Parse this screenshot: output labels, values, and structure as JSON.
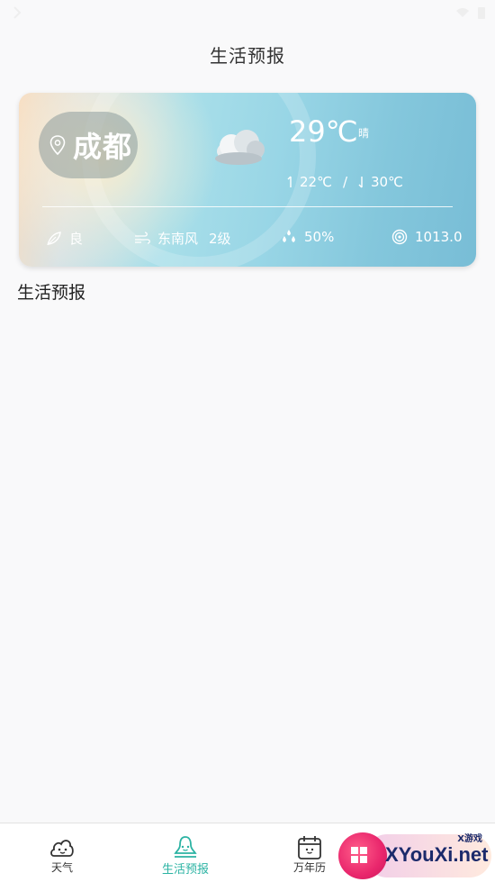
{
  "header": {
    "title": "生活预报"
  },
  "weather_card": {
    "city": "成都",
    "temperature": "29℃",
    "condition": "晴",
    "temp_low": "22℃",
    "range_separator": "/",
    "temp_high": "30℃",
    "air_quality": "良",
    "wind_direction": "东南风",
    "wind_level": "2级",
    "humidity": "50%",
    "pressure": "1013.0"
  },
  "section": {
    "label": "生活预报"
  },
  "tabs": [
    {
      "label": "天气",
      "icon": "weather-face-icon",
      "active": false
    },
    {
      "label": "生活预报",
      "icon": "bell-face-icon",
      "active": true
    },
    {
      "label": "万年历",
      "icon": "calendar-face-icon",
      "active": false
    }
  ],
  "watermark": {
    "text": "XYouXi.net",
    "small": "X游戏"
  },
  "colors": {
    "accent": "#2bb3a3",
    "background": "#f9f9fa"
  }
}
